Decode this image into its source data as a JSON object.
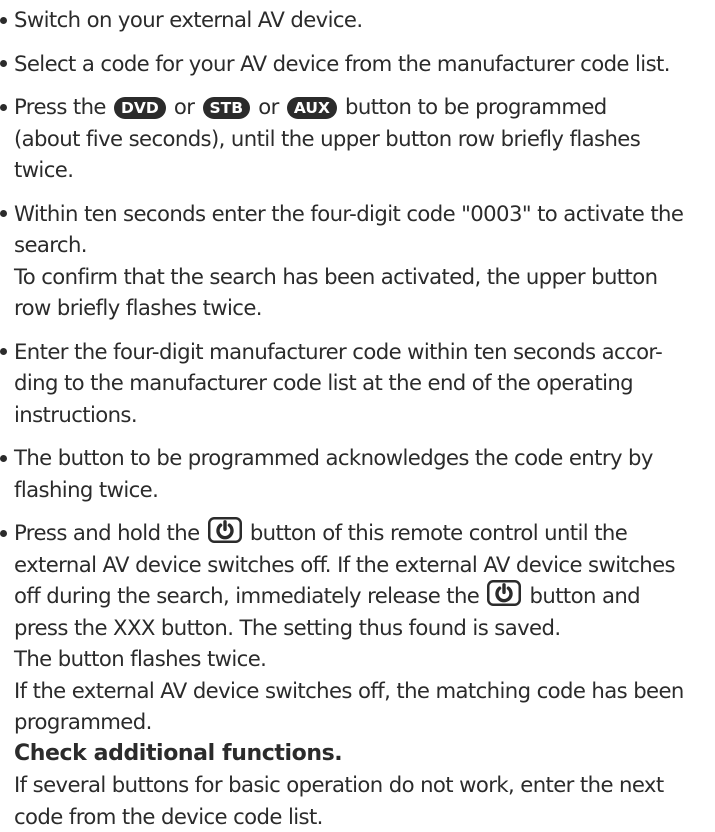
{
  "steps": [
    {
      "lines": [
        "Switch on your external AV device."
      ]
    },
    {
      "lines": [
        "Select a code for your AV device from the manufacturer code list."
      ]
    },
    {
      "s3_press": "Press the",
      "s3_key_dvd": "DVD",
      "s3_or1": "or",
      "s3_key_stb": "STB",
      "s3_or2": "or",
      "s3_key_aux": "AUX",
      "s3_after": "button to be programmed",
      "lines": [
        "(about five seconds), until the upper button row briefly flashes",
        "twice."
      ]
    },
    {
      "lines": [
        "Within ten seconds enter the four-digit code \"0003\" to activate the",
        "search.",
        "To confirm that the search has been activated, the upper button",
        "row briefly flashes twice."
      ]
    },
    {
      "lines": [
        "Enter the four-digit manufacturer code within ten seconds accor-",
        "ding to the manufacturer code list at the end of the operating",
        "instructions."
      ]
    },
    {
      "lines": [
        "The button to be programmed acknowledges the code entry by",
        "flashing twice."
      ]
    },
    {
      "s7_l1_before": "Press and hold the",
      "s7_l1_after": "button of this remote control until the",
      "s7_l2": "external AV device switches off. If the external AV device switches",
      "s7_l3_before": "off during the search, immediately release the",
      "s7_l3_after": "button and",
      "lines": [
        "press the XXX button. The setting thus found is saved.",
        "The button flashes twice.",
        "If the external AV device switches off, the matching code has been",
        "programmed."
      ],
      "heading": "Check additional functions.",
      "tail": [
        "If several buttons for basic operation do not work, enter the next",
        "code from the device code list."
      ]
    }
  ],
  "icons": {
    "power": "power-icon"
  },
  "colors": {
    "text": "#2b2b2b",
    "key_bg": "#2b2b2b",
    "key_text": "#ffffff"
  }
}
